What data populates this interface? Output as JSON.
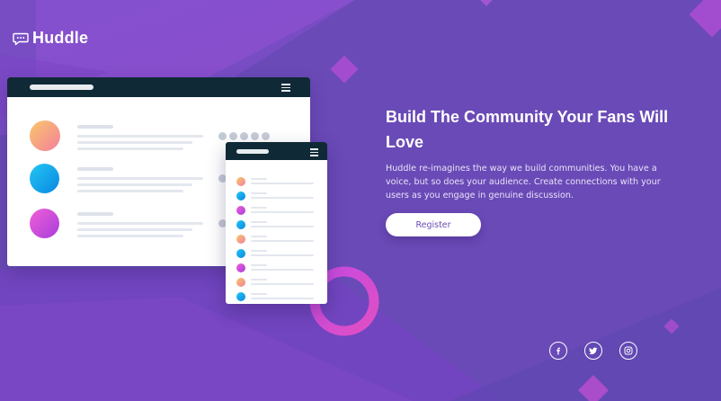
{
  "brand": {
    "name": "Huddle",
    "logo_icon": "chat-bubble-icon"
  },
  "hero": {
    "title": "Build The Community Your Fans Will Love",
    "description": "Huddle re-imagines the way we build communities. You have a voice, but so does your audience. Create connections with your users as you engage in genuine discussion.",
    "register_label": "Register"
  },
  "social": [
    {
      "name": "facebook",
      "icon": "facebook-icon"
    },
    {
      "name": "twitter",
      "icon": "twitter-icon"
    },
    {
      "name": "instagram",
      "icon": "instagram-icon"
    }
  ],
  "colors": {
    "background": "#6b4bb8",
    "accent_pink": "#d94dc8",
    "mockup_bar": "#0f2a36",
    "button_text": "#6b4bb8",
    "avatar_orange": "#f6a06a",
    "avatar_blue": "#0aa3e6",
    "avatar_magenta": "#d447d4"
  }
}
